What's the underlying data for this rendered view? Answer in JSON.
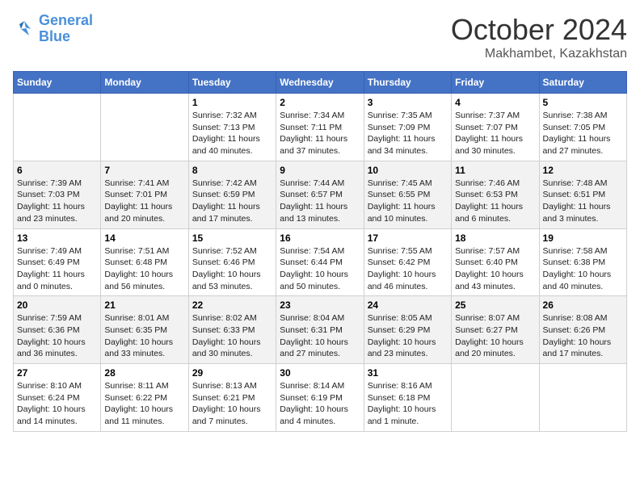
{
  "header": {
    "logo_line1": "General",
    "logo_line2": "Blue",
    "month": "October 2024",
    "location": "Makhambet, Kazakhstan"
  },
  "days_of_week": [
    "Sunday",
    "Monday",
    "Tuesday",
    "Wednesday",
    "Thursday",
    "Friday",
    "Saturday"
  ],
  "weeks": [
    [
      {
        "day": "",
        "content": ""
      },
      {
        "day": "",
        "content": ""
      },
      {
        "day": "1",
        "content": "Sunrise: 7:32 AM\nSunset: 7:13 PM\nDaylight: 11 hours and 40 minutes."
      },
      {
        "day": "2",
        "content": "Sunrise: 7:34 AM\nSunset: 7:11 PM\nDaylight: 11 hours and 37 minutes."
      },
      {
        "day": "3",
        "content": "Sunrise: 7:35 AM\nSunset: 7:09 PM\nDaylight: 11 hours and 34 minutes."
      },
      {
        "day": "4",
        "content": "Sunrise: 7:37 AM\nSunset: 7:07 PM\nDaylight: 11 hours and 30 minutes."
      },
      {
        "day": "5",
        "content": "Sunrise: 7:38 AM\nSunset: 7:05 PM\nDaylight: 11 hours and 27 minutes."
      }
    ],
    [
      {
        "day": "6",
        "content": "Sunrise: 7:39 AM\nSunset: 7:03 PM\nDaylight: 11 hours and 23 minutes."
      },
      {
        "day": "7",
        "content": "Sunrise: 7:41 AM\nSunset: 7:01 PM\nDaylight: 11 hours and 20 minutes."
      },
      {
        "day": "8",
        "content": "Sunrise: 7:42 AM\nSunset: 6:59 PM\nDaylight: 11 hours and 17 minutes."
      },
      {
        "day": "9",
        "content": "Sunrise: 7:44 AM\nSunset: 6:57 PM\nDaylight: 11 hours and 13 minutes."
      },
      {
        "day": "10",
        "content": "Sunrise: 7:45 AM\nSunset: 6:55 PM\nDaylight: 11 hours and 10 minutes."
      },
      {
        "day": "11",
        "content": "Sunrise: 7:46 AM\nSunset: 6:53 PM\nDaylight: 11 hours and 6 minutes."
      },
      {
        "day": "12",
        "content": "Sunrise: 7:48 AM\nSunset: 6:51 PM\nDaylight: 11 hours and 3 minutes."
      }
    ],
    [
      {
        "day": "13",
        "content": "Sunrise: 7:49 AM\nSunset: 6:49 PM\nDaylight: 11 hours and 0 minutes."
      },
      {
        "day": "14",
        "content": "Sunrise: 7:51 AM\nSunset: 6:48 PM\nDaylight: 10 hours and 56 minutes."
      },
      {
        "day": "15",
        "content": "Sunrise: 7:52 AM\nSunset: 6:46 PM\nDaylight: 10 hours and 53 minutes."
      },
      {
        "day": "16",
        "content": "Sunrise: 7:54 AM\nSunset: 6:44 PM\nDaylight: 10 hours and 50 minutes."
      },
      {
        "day": "17",
        "content": "Sunrise: 7:55 AM\nSunset: 6:42 PM\nDaylight: 10 hours and 46 minutes."
      },
      {
        "day": "18",
        "content": "Sunrise: 7:57 AM\nSunset: 6:40 PM\nDaylight: 10 hours and 43 minutes."
      },
      {
        "day": "19",
        "content": "Sunrise: 7:58 AM\nSunset: 6:38 PM\nDaylight: 10 hours and 40 minutes."
      }
    ],
    [
      {
        "day": "20",
        "content": "Sunrise: 7:59 AM\nSunset: 6:36 PM\nDaylight: 10 hours and 36 minutes."
      },
      {
        "day": "21",
        "content": "Sunrise: 8:01 AM\nSunset: 6:35 PM\nDaylight: 10 hours and 33 minutes."
      },
      {
        "day": "22",
        "content": "Sunrise: 8:02 AM\nSunset: 6:33 PM\nDaylight: 10 hours and 30 minutes."
      },
      {
        "day": "23",
        "content": "Sunrise: 8:04 AM\nSunset: 6:31 PM\nDaylight: 10 hours and 27 minutes."
      },
      {
        "day": "24",
        "content": "Sunrise: 8:05 AM\nSunset: 6:29 PM\nDaylight: 10 hours and 23 minutes."
      },
      {
        "day": "25",
        "content": "Sunrise: 8:07 AM\nSunset: 6:27 PM\nDaylight: 10 hours and 20 minutes."
      },
      {
        "day": "26",
        "content": "Sunrise: 8:08 AM\nSunset: 6:26 PM\nDaylight: 10 hours and 17 minutes."
      }
    ],
    [
      {
        "day": "27",
        "content": "Sunrise: 8:10 AM\nSunset: 6:24 PM\nDaylight: 10 hours and 14 minutes."
      },
      {
        "day": "28",
        "content": "Sunrise: 8:11 AM\nSunset: 6:22 PM\nDaylight: 10 hours and 11 minutes."
      },
      {
        "day": "29",
        "content": "Sunrise: 8:13 AM\nSunset: 6:21 PM\nDaylight: 10 hours and 7 minutes."
      },
      {
        "day": "30",
        "content": "Sunrise: 8:14 AM\nSunset: 6:19 PM\nDaylight: 10 hours and 4 minutes."
      },
      {
        "day": "31",
        "content": "Sunrise: 8:16 AM\nSunset: 6:18 PM\nDaylight: 10 hours and 1 minute."
      },
      {
        "day": "",
        "content": ""
      },
      {
        "day": "",
        "content": ""
      }
    ]
  ]
}
